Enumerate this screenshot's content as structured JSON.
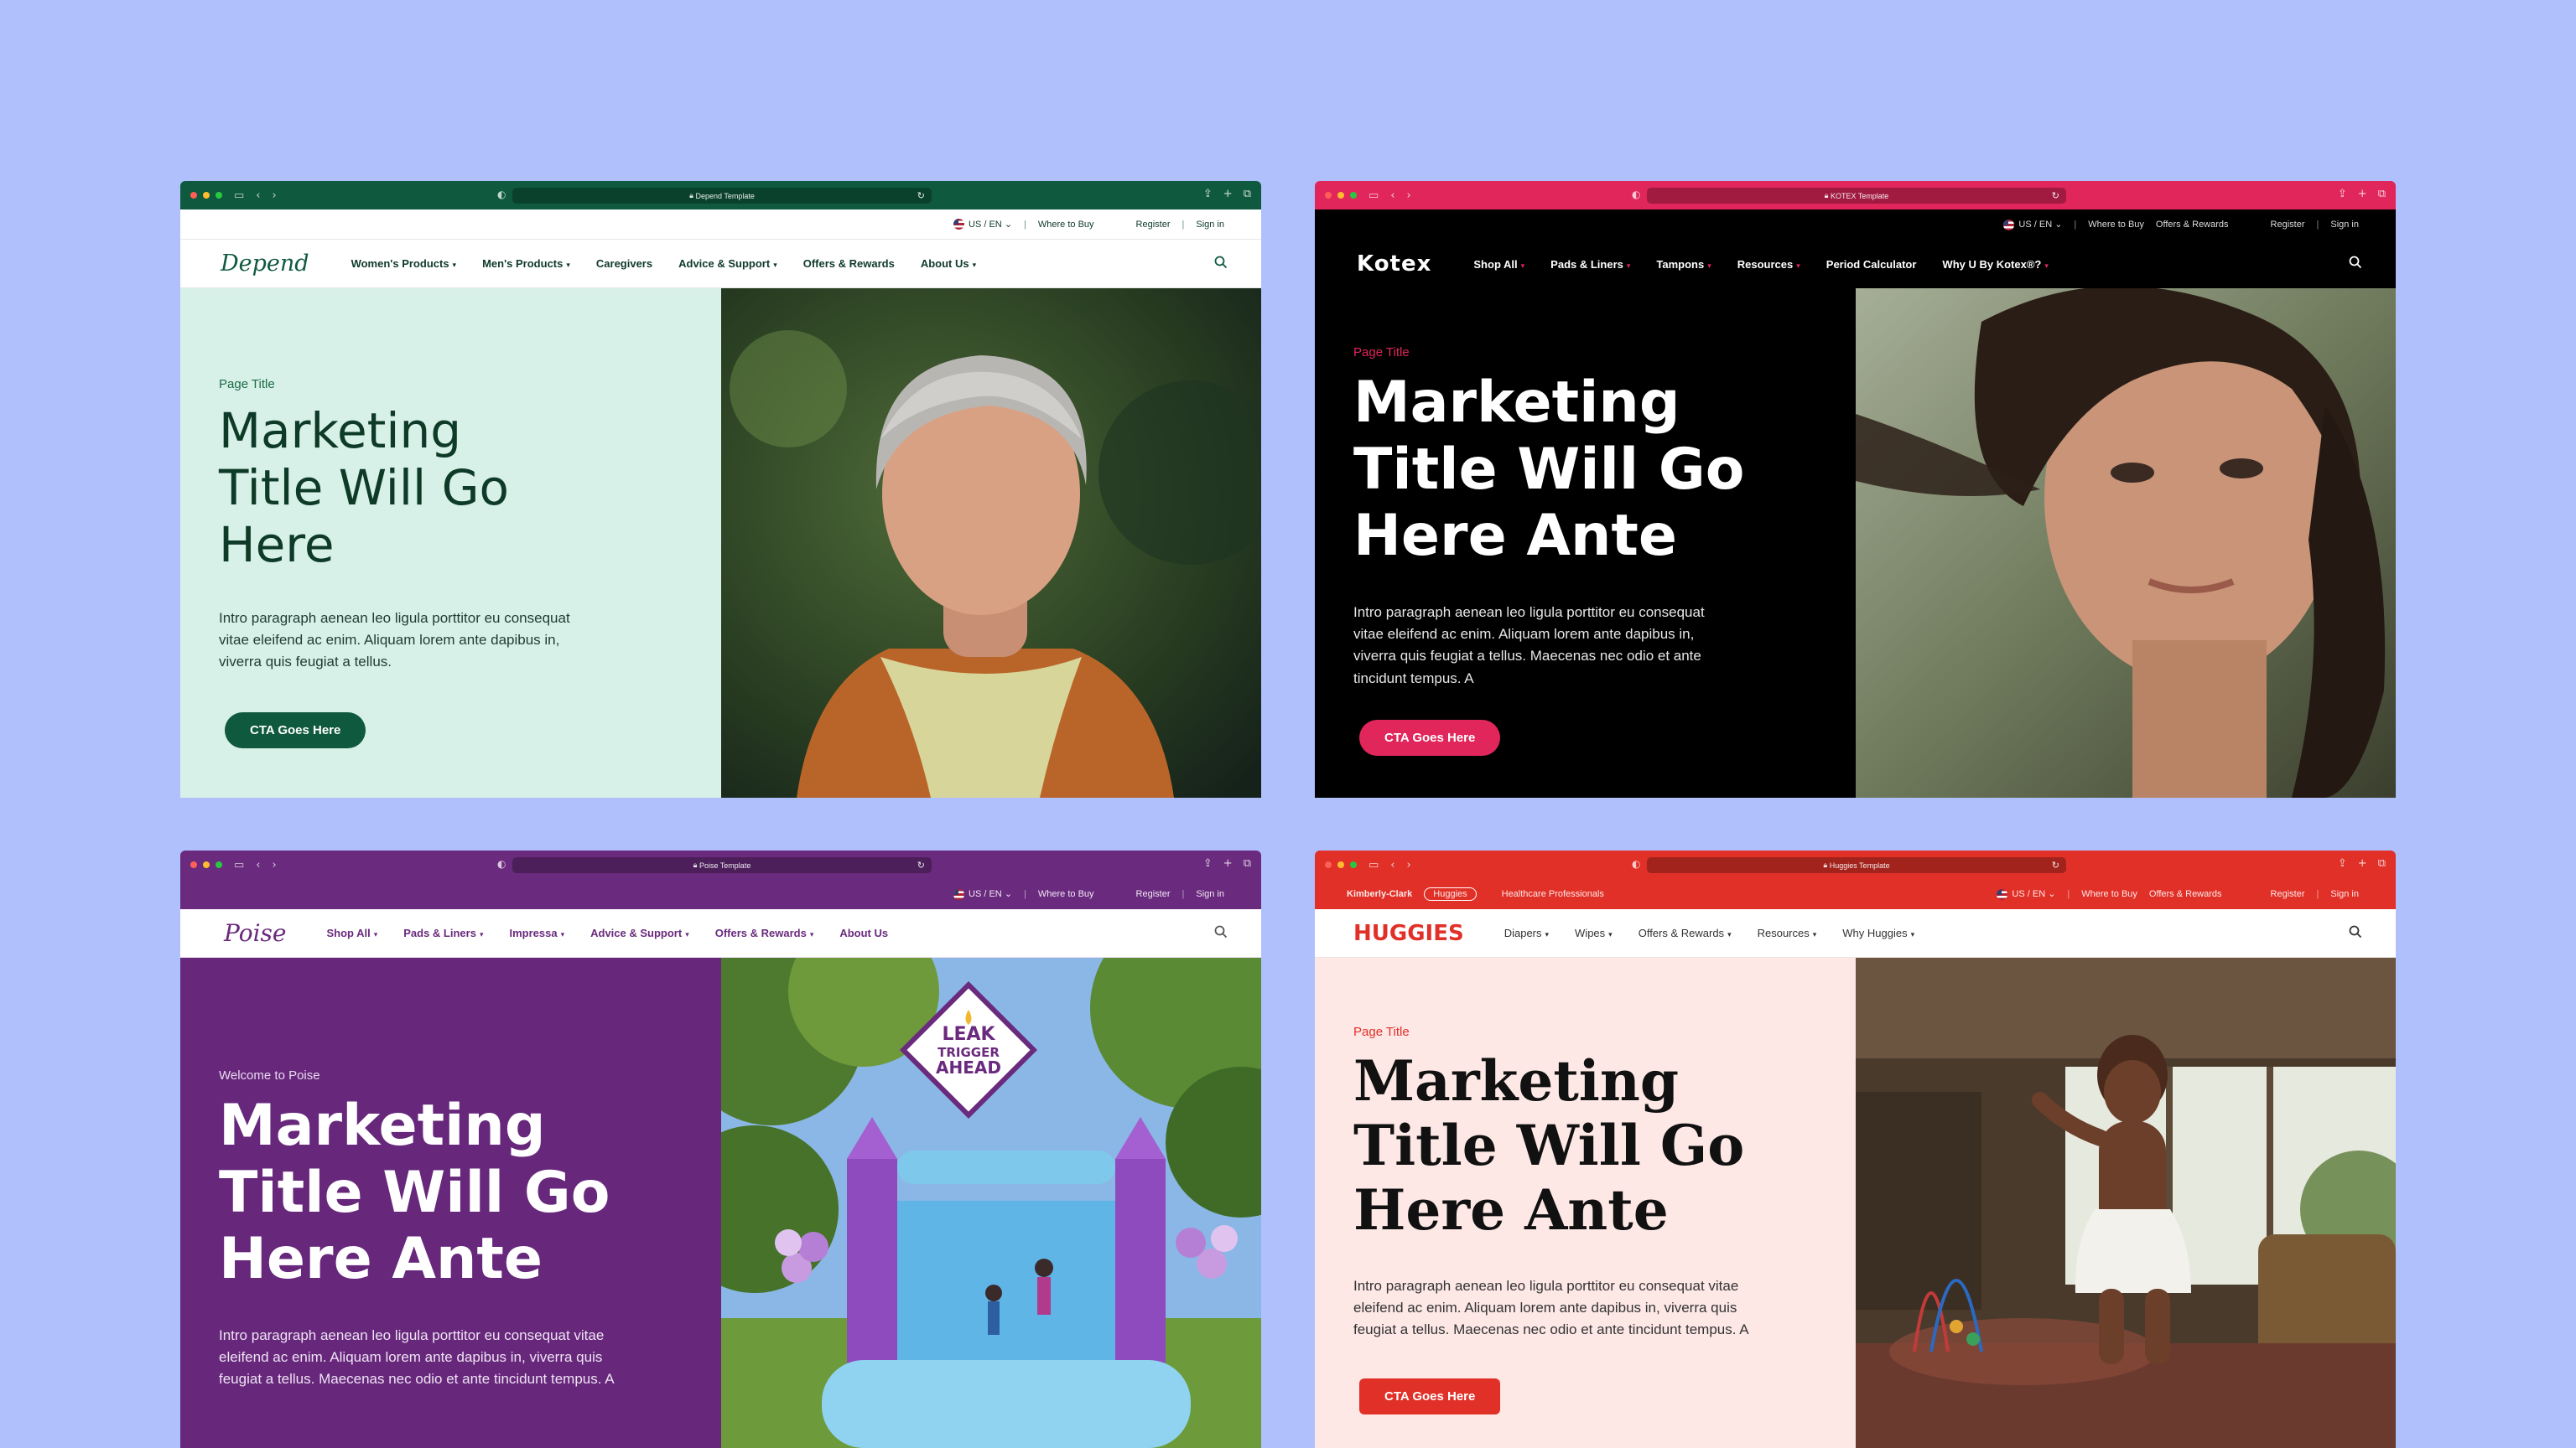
{
  "depend": {
    "tab_title": "Depend Template",
    "util": {
      "locale": "US / EN",
      "where_to_buy": "Where to Buy",
      "register": "Register",
      "sign_in": "Sign in"
    },
    "logo": "Depend",
    "nav": [
      "Women's Products",
      "Men's Products",
      "Caregivers",
      "Advice & Support",
      "Offers & Rewards",
      "About Us"
    ],
    "eyebrow": "Page Title",
    "title_lines": [
      "Marketing",
      "Title Will Go",
      "Here"
    ],
    "intro_lines": [
      "Intro paragraph aenean leo ligula porttitor eu consequat",
      "vitae eleifend ac enim. Aliquam lorem ante dapibus in,",
      "viverra quis feugiat a tellus."
    ],
    "cta": "CTA Goes Here",
    "colors": {
      "primary": "#0f5a3f",
      "hero_bg": "#d7f0e8"
    }
  },
  "kotex": {
    "tab_title": "KOTEX Template",
    "util": {
      "locale": "US / EN",
      "where_to_buy": "Where to Buy",
      "offers": "Offers & Rewards",
      "register": "Register",
      "sign_in": "Sign in"
    },
    "logo": "Kotex",
    "nav": [
      "Shop All",
      "Pads & Liners",
      "Tampons",
      "Resources",
      "Period Calculator",
      "Why U By Kotex®?"
    ],
    "eyebrow": "Page Title",
    "title_lines": [
      "Marketing",
      "Title Will Go",
      "Here Ante"
    ],
    "intro_lines": [
      "Intro paragraph aenean leo ligula porttitor eu consequat",
      "vitae eleifend ac enim. Aliquam lorem ante dapibus in,",
      "viverra quis feugiat a tellus. Maecenas nec odio et ante",
      "tincidunt tempus. A"
    ],
    "cta": "CTA Goes Here",
    "colors": {
      "primary": "#e0265b",
      "hero_bg": "#000000"
    }
  },
  "poise": {
    "tab_title": "Poise Template",
    "util": {
      "locale": "US / EN",
      "where_to_buy": "Where to Buy",
      "register": "Register",
      "sign_in": "Sign in"
    },
    "logo": "Poise",
    "nav": [
      "Shop All",
      "Pads & Liners",
      "Impressa",
      "Advice & Support",
      "Offers & Rewards",
      "About Us"
    ],
    "eyebrow": "Welcome to Poise",
    "title_lines": [
      "Marketing",
      "Title Will Go",
      "Here Ante"
    ],
    "intro_lines": [
      "Intro paragraph aenean leo ligula porttitor eu consequat vitae",
      "eleifend ac enim. Aliquam lorem ante dapibus in, viverra quis",
      "feugiat a tellus. Maecenas nec odio et ante tincidunt tempus. A"
    ],
    "sign_lines": [
      "LEAK",
      "TRIGGER",
      "AHEAD"
    ],
    "colors": {
      "primary": "#67287c"
    }
  },
  "huggies": {
    "tab_title": "Huggies Template",
    "util": {
      "kc_logo": "Kimberly-Clark",
      "huggies_pill": "Huggies",
      "hcp": "Healthcare Professionals",
      "locale": "US / EN",
      "where_to_buy": "Where to Buy",
      "offers": "Offers & Rewards",
      "register": "Register",
      "sign_in": "Sign in"
    },
    "logo": "HUGGIES",
    "nav": [
      "Diapers",
      "Wipes",
      "Offers & Rewards",
      "Resources",
      "Why Huggies"
    ],
    "eyebrow": "Page Title",
    "title_lines": [
      "Marketing",
      "Title Will Go",
      "Here Ante"
    ],
    "intro_lines": [
      "Intro paragraph aenean leo ligula porttitor eu consequat vitae",
      "eleifend ac enim. Aliquam lorem ante dapibus in, viverra quis",
      "feugiat a tellus. Maecenas nec odio et ante tincidunt tempus. A"
    ],
    "cta": "CTA Goes Here",
    "colors": {
      "primary": "#e13028",
      "hero_bg": "#fde8e6"
    }
  }
}
